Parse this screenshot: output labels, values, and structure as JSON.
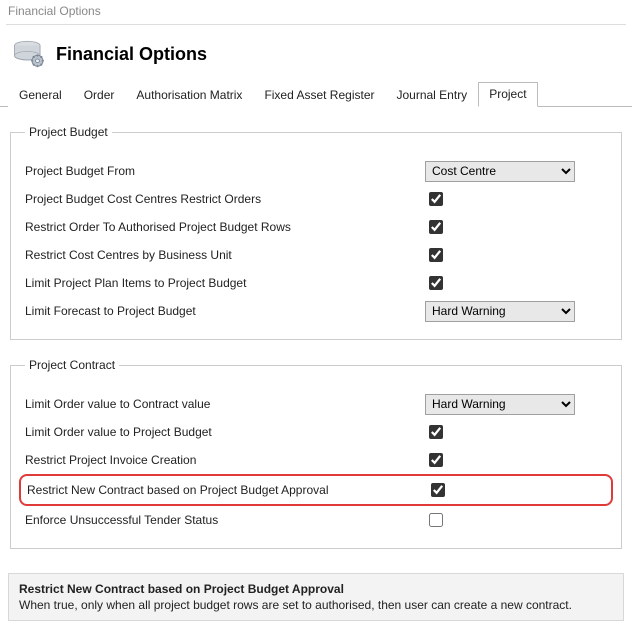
{
  "window_title": "Financial Options",
  "page_heading": "Financial Options",
  "tabs": {
    "general": "General",
    "order": "Order",
    "auth_matrix": "Authorisation Matrix",
    "fixed_asset": "Fixed Asset Register",
    "journal": "Journal Entry",
    "project": "Project"
  },
  "group_budget": {
    "legend": "Project Budget",
    "rows": {
      "from": {
        "label": "Project Budget From",
        "value": "Cost Centre"
      },
      "cc_restrict": {
        "label": "Project Budget Cost Centres Restrict Orders"
      },
      "restrict_rows": {
        "label": "Restrict Order To Authorised Project Budget Rows"
      },
      "restrict_cc_bu": {
        "label": "Restrict Cost Centres by Business Unit"
      },
      "limit_plan": {
        "label": "Limit Project Plan Items to Project Budget"
      },
      "limit_forecast": {
        "label": "Limit Forecast to Project Budget",
        "value": "Hard Warning"
      }
    }
  },
  "group_contract": {
    "legend": "Project Contract",
    "rows": {
      "limit_order_contract": {
        "label": "Limit Order value to Contract value",
        "value": "Hard Warning"
      },
      "limit_order_budget": {
        "label": "Limit Order value to Project Budget"
      },
      "restrict_invoice": {
        "label": "Restrict Project Invoice Creation"
      },
      "restrict_new_contract": {
        "label": "Restrict New Contract based on Project Budget Approval"
      },
      "enforce_tender": {
        "label": "Enforce Unsuccessful Tender Status"
      }
    }
  },
  "description": {
    "title": "Restrict New Contract based on Project Budget Approval",
    "body": "When true, only when all project budget rows are set to authorised, then user can create a new contract."
  }
}
